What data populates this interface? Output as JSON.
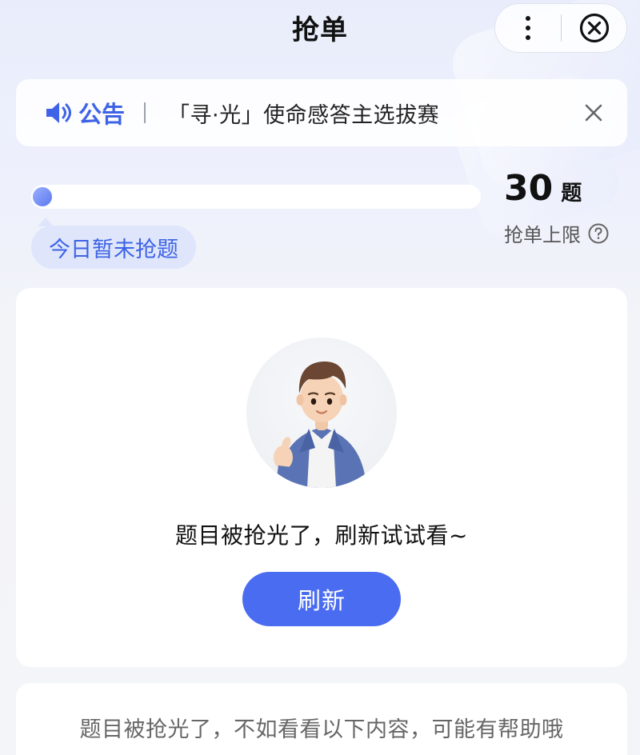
{
  "header": {
    "title": "抢单"
  },
  "notice": {
    "label": "公告",
    "text": "「寻·光」使命感答主选拔赛"
  },
  "progress": {
    "value_fraction": 0.0,
    "status_tag": "今日暂未抢题"
  },
  "quota": {
    "number": "30",
    "unit": "题",
    "label": "抢单上限"
  },
  "empty_state": {
    "message": "题目被抢光了，刷新试试看~",
    "refresh_label": "刷新"
  },
  "recommend": {
    "hint": "题目被抢光了，不如看看以下内容，可能有帮助哦"
  },
  "colors": {
    "accent": "#4a6cf0",
    "notice_label": "#3e63e6",
    "tag_bg": "#dfe6fb"
  },
  "icons": {
    "more": "more-vertical-icon",
    "close": "close-circle-icon",
    "speaker": "speaker-icon",
    "dismiss": "close-icon",
    "help": "question-circle-icon"
  }
}
